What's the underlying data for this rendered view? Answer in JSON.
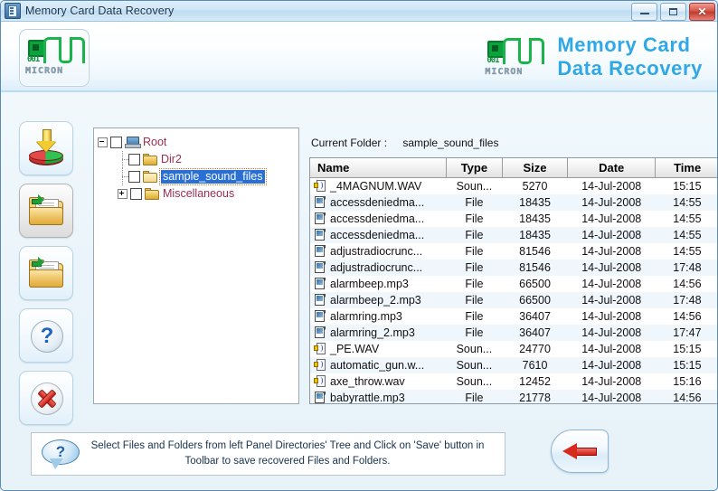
{
  "window": {
    "title": "Memory Card Data Recovery",
    "controls": {
      "minimize": "–",
      "maximize": "□",
      "close": "✕"
    }
  },
  "header": {
    "brand_line1": "Memory Card",
    "brand_line2": "Data Recovery",
    "logo_digits": "001",
    "logo_word": "MICRON"
  },
  "toolbar": {
    "buttons": [
      {
        "name": "save-recovered-data",
        "icon": "save-disk-icon"
      },
      {
        "name": "open-folder-grey",
        "icon": "folder-grey-icon"
      },
      {
        "name": "open-folder",
        "icon": "folder-open-icon"
      },
      {
        "name": "help",
        "icon": "question-icon",
        "glyph": "?"
      },
      {
        "name": "close",
        "icon": "close-x-icon"
      }
    ]
  },
  "tree": {
    "items": [
      {
        "label": "Root",
        "level": 0,
        "expander": "minus",
        "icon": "computer-icon",
        "selected": false
      },
      {
        "label": "Dir2",
        "level": 1,
        "expander": "none",
        "icon": "folder-icon",
        "selected": false
      },
      {
        "label": "sample_sound_files",
        "level": 1,
        "expander": "none",
        "icon": "folder-open-icon",
        "selected": true
      },
      {
        "label": "Miscellaneous",
        "level": 1,
        "expander": "plus",
        "icon": "folder-icon",
        "selected": false
      }
    ]
  },
  "main": {
    "current_folder_label": "Current Folder :",
    "current_folder_value": "sample_sound_files",
    "columns": [
      "Name",
      "Type",
      "Size",
      "Date",
      "Time"
    ],
    "rows": [
      {
        "icon": "sound-file-icon",
        "name": "_4MAGNUM.WAV",
        "type": "Soun...",
        "size": "5270",
        "date": "14-Jul-2008",
        "time": "15:15"
      },
      {
        "icon": "generic-file-icon",
        "name": "accessdeniedma...",
        "type": "File",
        "size": "18435",
        "date": "14-Jul-2008",
        "time": "14:55"
      },
      {
        "icon": "generic-file-icon",
        "name": "accessdeniedma...",
        "type": "File",
        "size": "18435",
        "date": "14-Jul-2008",
        "time": "14:55"
      },
      {
        "icon": "generic-file-icon",
        "name": "accessdeniedma...",
        "type": "File",
        "size": "18435",
        "date": "14-Jul-2008",
        "time": "14:55"
      },
      {
        "icon": "generic-file-icon",
        "name": "adjustradiocrunc...",
        "type": "File",
        "size": "81546",
        "date": "14-Jul-2008",
        "time": "14:55"
      },
      {
        "icon": "generic-file-icon",
        "name": "adjustradiocrunc...",
        "type": "File",
        "size": "81546",
        "date": "14-Jul-2008",
        "time": "17:48"
      },
      {
        "icon": "generic-file-icon",
        "name": "alarmbeep.mp3",
        "type": "File",
        "size": "66500",
        "date": "14-Jul-2008",
        "time": "14:56"
      },
      {
        "icon": "generic-file-icon",
        "name": "alarmbeep_2.mp3",
        "type": "File",
        "size": "66500",
        "date": "14-Jul-2008",
        "time": "17:48"
      },
      {
        "icon": "generic-file-icon",
        "name": "alarmring.mp3",
        "type": "File",
        "size": "36407",
        "date": "14-Jul-2008",
        "time": "14:56"
      },
      {
        "icon": "generic-file-icon",
        "name": "alarmring_2.mp3",
        "type": "File",
        "size": "36407",
        "date": "14-Jul-2008",
        "time": "17:47"
      },
      {
        "icon": "sound-file-icon",
        "name": "_PE.WAV",
        "type": "Soun...",
        "size": "24770",
        "date": "14-Jul-2008",
        "time": "15:15"
      },
      {
        "icon": "sound-file-icon",
        "name": "automatic_gun.w...",
        "type": "Soun...",
        "size": "7610",
        "date": "14-Jul-2008",
        "time": "15:15"
      },
      {
        "icon": "sound-file-icon",
        "name": "axe_throw.wav",
        "type": "Soun...",
        "size": "12452",
        "date": "14-Jul-2008",
        "time": "15:16"
      },
      {
        "icon": "generic-file-icon",
        "name": "babyrattle.mp3",
        "type": "File",
        "size": "21778",
        "date": "14-Jul-2008",
        "time": "14:56"
      }
    ]
  },
  "footer": {
    "hint_glyph": "?",
    "hint_text": "Select Files and Folders from left Panel Directories' Tree and Click on 'Save' button in Toolbar to save recovered Files and Folders.",
    "back_button": "back-arrow-icon"
  },
  "colors": {
    "brand_blue": "#2fa8e8",
    "selection_blue": "#2a6fd4",
    "tree_text": "#9b2d4f",
    "body_bg": "#eaf4fa"
  }
}
